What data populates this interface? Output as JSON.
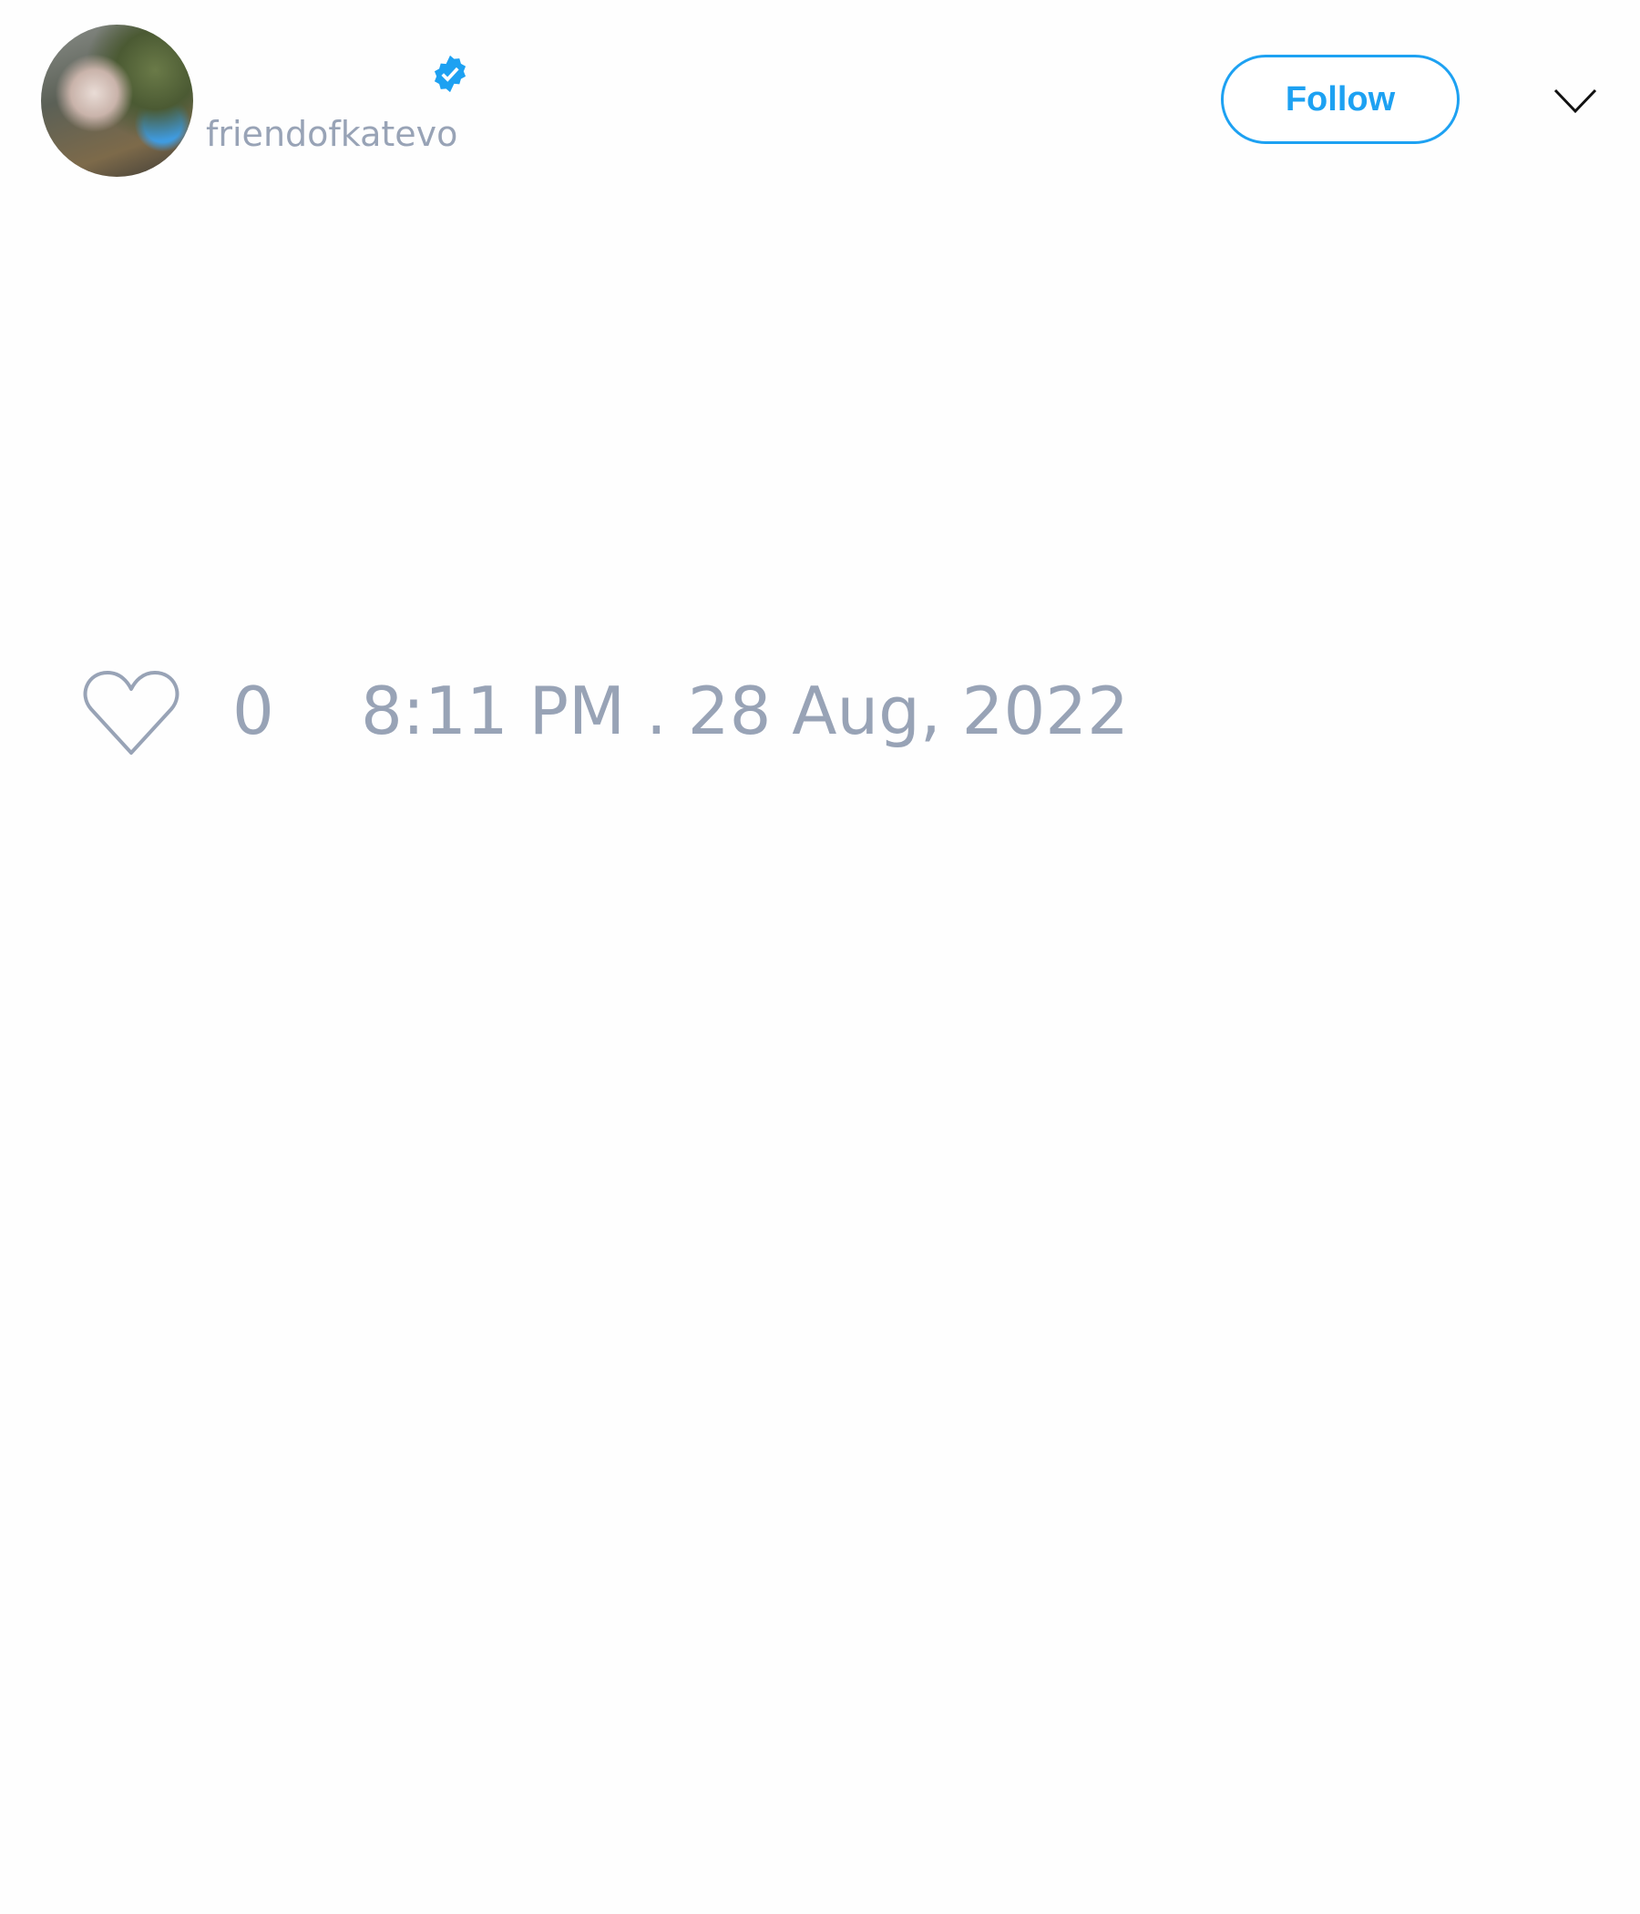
{
  "user": {
    "handle": "friendofkatevo",
    "verified": true,
    "avatar": "profile-photo"
  },
  "header": {
    "follow_label": "Follow",
    "menu_icon": "chevron-down-icon"
  },
  "tweet": {
    "like_icon": "heart-icon",
    "like_count": "0",
    "timestamp": "8:11 PM . 28 Aug, 2022"
  },
  "colors": {
    "accent": "#1da1f2",
    "muted_text": "#98a3b6"
  }
}
